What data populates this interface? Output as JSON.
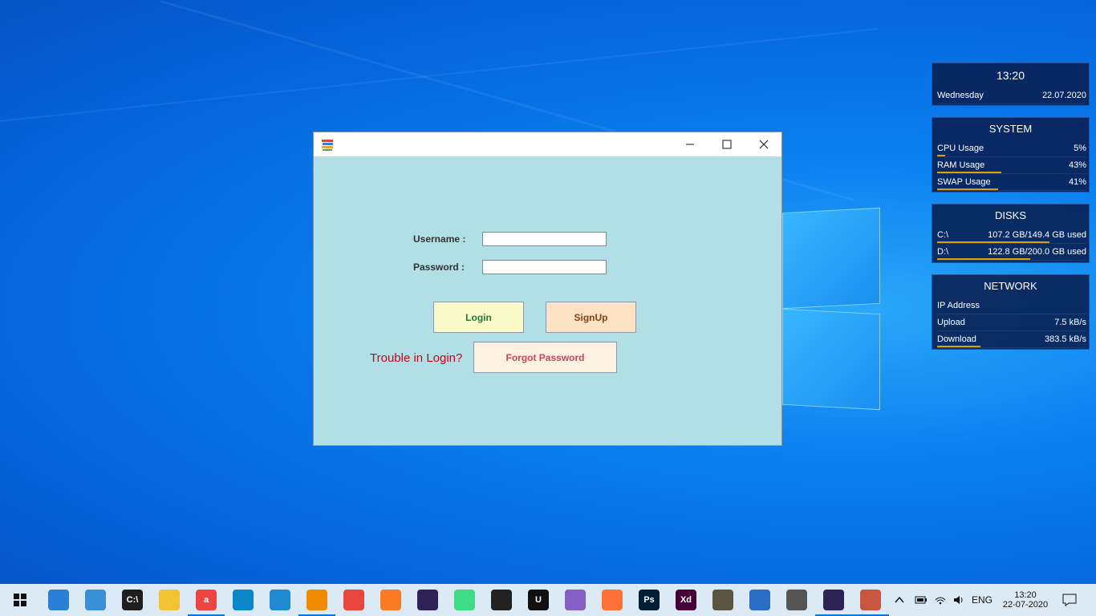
{
  "window": {
    "minimize_glyph": "–",
    "close_glyph": "✕"
  },
  "login_form": {
    "username_label": "Username :",
    "password_label": "Password :",
    "username_value": "",
    "password_value": "",
    "login_label": "Login",
    "signup_label": "SignUp",
    "trouble_text": "Trouble in Login?",
    "forgot_label": "Forgot Password"
  },
  "colors": {
    "form_bg": "#b0dfe5",
    "login_btn": "#fafac8",
    "login_text": "#1e7a3a",
    "signup_btn": "#fde3c3",
    "signup_text": "#8a3c10",
    "forgot_btn": "#fdf1e4",
    "forgot_text": "#c4475a",
    "trouble_text": "#d4001a"
  },
  "widgets": {
    "clock": {
      "time": "13:20",
      "day": "Wednesday",
      "date": "22.07.2020"
    },
    "system": {
      "title": "SYSTEM",
      "rows": [
        {
          "label": "CPU Usage",
          "value": "5%",
          "level": 0.05
        },
        {
          "label": "RAM Usage",
          "value": "43%",
          "level": 0.43
        },
        {
          "label": "SWAP Usage",
          "value": "41%",
          "level": 0.41
        }
      ]
    },
    "disks": {
      "title": "DISKS",
      "rows": [
        {
          "label": "C:\\",
          "value": "107.2 GB/149.4 GB used"
        },
        {
          "label": "D:\\",
          "value": "122.8 GB/200.0 GB used"
        }
      ]
    },
    "network": {
      "title": "NETWORK",
      "rows": [
        {
          "label": "IP Address",
          "value": ""
        },
        {
          "label": "Upload",
          "value": "7.5 kB/s"
        },
        {
          "label": "Download",
          "value": "383.5 kB/s"
        }
      ]
    }
  },
  "taskbar": {
    "apps": [
      {
        "name": "file-transfer-icon",
        "text": "",
        "color": "#2a7fd6"
      },
      {
        "name": "control-panel-icon",
        "text": "",
        "color": "#3a8fd8"
      },
      {
        "name": "terminal-icon",
        "text": "C:\\",
        "color": "#1e1e1e"
      },
      {
        "name": "file-explorer-icon",
        "text": "",
        "color": "#f1c232"
      },
      {
        "name": "anydesk-icon",
        "text": "a",
        "color": "#ef4444"
      },
      {
        "name": "edge-icon",
        "text": "",
        "color": "#0b86c8"
      },
      {
        "name": "vscode-icon",
        "text": "",
        "color": "#1f8ad2"
      },
      {
        "name": "vlc-icon",
        "text": "",
        "color": "#f08a00"
      },
      {
        "name": "chrome-icon",
        "text": "",
        "color": "#e8453c"
      },
      {
        "name": "xampp-icon",
        "text": "",
        "color": "#fb7a24"
      },
      {
        "name": "eclipse-icon",
        "text": "",
        "color": "#2c2255"
      },
      {
        "name": "android-studio-icon",
        "text": "",
        "color": "#3ddc84"
      },
      {
        "name": "unity-icon",
        "text": "",
        "color": "#222222"
      },
      {
        "name": "unreal-icon",
        "text": "U",
        "color": "#111111"
      },
      {
        "name": "visual-studio-icon",
        "text": "",
        "color": "#865fc5"
      },
      {
        "name": "firefox-icon",
        "text": "",
        "color": "#ff7139"
      },
      {
        "name": "photoshop-icon",
        "text": "Ps",
        "color": "#001e36"
      },
      {
        "name": "adobe-xd-icon",
        "text": "Xd",
        "color": "#470137"
      },
      {
        "name": "gimp-icon",
        "text": "",
        "color": "#5c5543"
      },
      {
        "name": "document-icon",
        "text": "",
        "color": "#2b6cc4"
      },
      {
        "name": "drive-icon",
        "text": "",
        "color": "#555555"
      },
      {
        "name": "eclipse-active-icon",
        "text": "",
        "color": "#2c2255"
      },
      {
        "name": "books-app-icon",
        "text": "",
        "color": "#c8553d"
      }
    ],
    "tray": {
      "language": "ENG",
      "time": "13:20",
      "date": "22-07-2020"
    }
  }
}
